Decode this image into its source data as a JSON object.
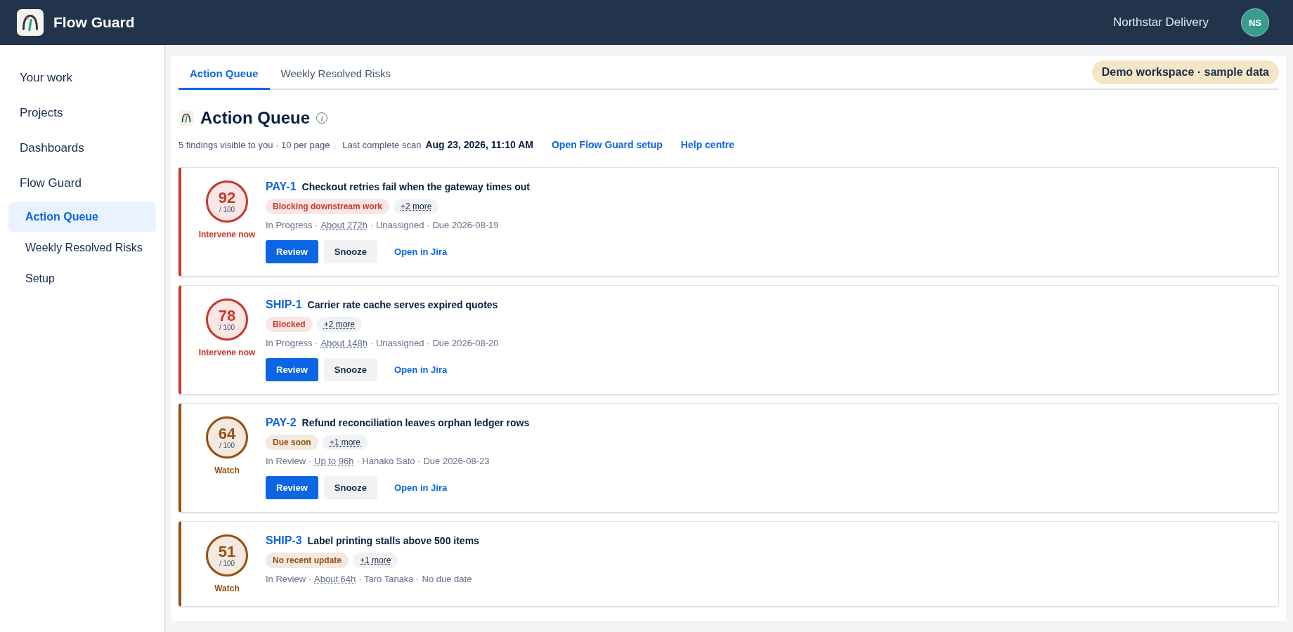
{
  "header": {
    "app_name": "Flow Guard",
    "workspace": "Northstar Delivery",
    "avatar": "NS"
  },
  "sidebar": {
    "items": [
      {
        "label": "Your work",
        "selected": false
      },
      {
        "label": "Projects",
        "selected": false
      },
      {
        "label": "Dashboards",
        "selected": false
      },
      {
        "label": "Flow Guard",
        "selected": false,
        "children": [
          {
            "label": "Action Queue",
            "selected": true
          },
          {
            "label": "Weekly Resolved Risks",
            "selected": false
          },
          {
            "label": "Setup",
            "selected": false
          }
        ]
      }
    ]
  },
  "tabs": [
    {
      "label": "Action Queue",
      "selected": true
    },
    {
      "label": "Weekly Resolved Risks",
      "selected": false
    }
  ],
  "demo_badge": "Demo workspace · sample data",
  "page": {
    "title": "Action Queue",
    "info": "i",
    "summary": "5 findings visible to you · 10 per page",
    "scan_label": "Last complete scan",
    "scan_time": "Aug 23, 2026, 11:10 AM",
    "links": [
      "Open Flow Guard setup",
      "Help centre"
    ]
  },
  "findings": [
    {
      "color": "#c9372c",
      "score": "92",
      "out_of": "/ 100",
      "verdict": "Intervene now",
      "key": "PAY-1",
      "title": "Checkout retries fail when the gateway times out",
      "tag": "Blocking downstream work",
      "more": "+2 more",
      "status": "In Progress ·",
      "age": "About 272h",
      "assignee": "· Unassigned ·",
      "due": "Due 2026-08-19",
      "actions": [
        "Review",
        "Snooze",
        "Open in Jira"
      ]
    },
    {
      "color": "#c9372c",
      "score": "78",
      "out_of": "/ 100",
      "verdict": "Intervene now",
      "key": "SHIP-1",
      "title": "Carrier rate cache serves expired quotes",
      "tag": "Blocked",
      "more": "+2 more",
      "status": "In Progress ·",
      "age": "About 148h",
      "assignee": "· Unassigned ·",
      "due": "Due 2026-08-20",
      "actions": [
        "Review",
        "Snooze",
        "Open in Jira"
      ]
    },
    {
      "color": "#974f0c",
      "score": "64",
      "out_of": "/ 100",
      "verdict": "Watch",
      "key": "PAY-2",
      "title": "Refund reconciliation leaves orphan ledger rows",
      "tag": "Due soon",
      "more": "+1 more",
      "status": "In Review ·",
      "age": "Up to 96h",
      "assignee": "· Hanako Sato ·",
      "due": "Due 2026-08-23",
      "actions": [
        "Review",
        "Snooze",
        "Open in Jira"
      ]
    },
    {
      "color": "#974f0c",
      "score": "51",
      "out_of": "/ 100",
      "verdict": "Watch",
      "key": "SHIP-3",
      "title": "Label printing stalls above 500 items",
      "tag": "No recent update",
      "more": "+1 more",
      "status": "In Review ·",
      "age": "About 64h",
      "assignee": "· Taro Tanaka ·",
      "due": "No due date"
    }
  ]
}
